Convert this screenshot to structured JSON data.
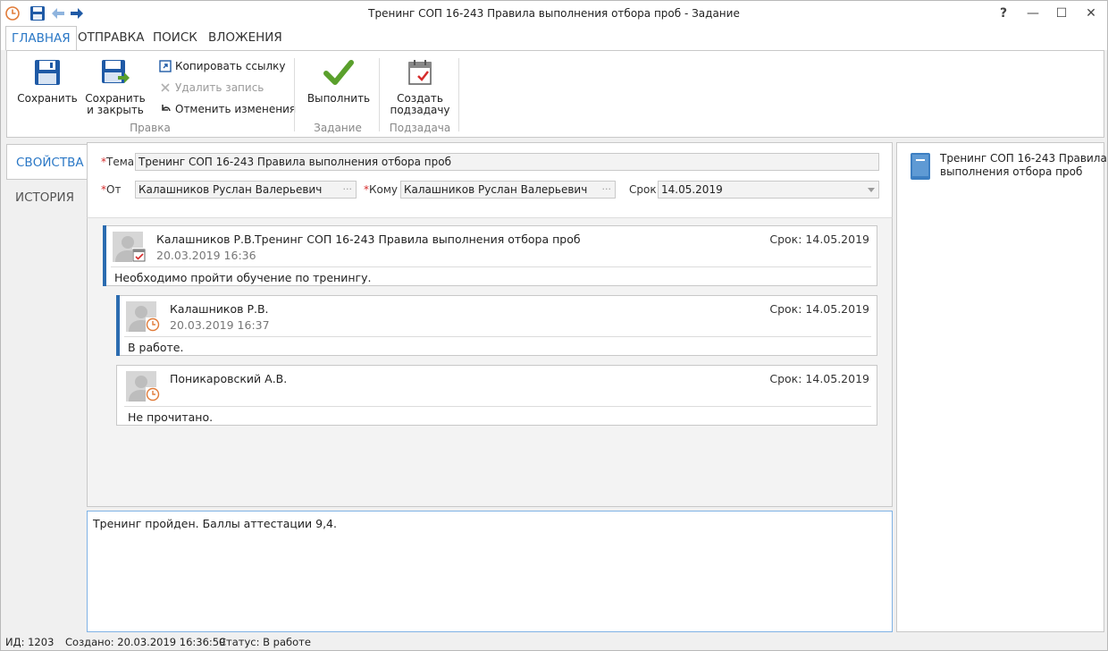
{
  "window": {
    "title": "Тренинг СОП 16-243 Правила выполнения отбора проб - Задание",
    "help_label": "?",
    "minimize_label": "—",
    "maximize_label": "☐",
    "close_label": "✕"
  },
  "tabs": [
    "ГЛАВНАЯ",
    "ОТПРАВКА",
    "ПОИСК",
    "ВЛОЖЕНИЯ"
  ],
  "ribbon": {
    "save": "Сохранить",
    "save_close_line1": "Сохранить",
    "save_close_line2": "и закрыть",
    "copy_link": "Копировать ссылку",
    "delete_record": "Удалить запись",
    "undo_changes": "Отменить изменения",
    "group_edit": "Правка",
    "complete": "Выполнить",
    "group_task": "Задание",
    "create_sub_line1": "Создать",
    "create_sub_line2": "подзадачу",
    "group_subtask": "Подзадача"
  },
  "side_tabs": [
    "СВОЙСТВА",
    "ИСТОРИЯ"
  ],
  "form": {
    "subject_label": "Тема",
    "subject_value": "Тренинг СОП 16-243 Правила выполнения отбора проб",
    "from_label": "От",
    "from_value": "Калашников Руслан Валерьевич",
    "to_label": "Кому",
    "to_value": "Калашников Руслан Валерьевич",
    "due_label": "Срок",
    "due_value": "14.05.2019",
    "required_mark": "*",
    "dots": "···"
  },
  "thread": [
    {
      "author": "Калашников Р.В.",
      "subject": "Тренинг СОП 16-243 Правила выполнения отбора проб",
      "date": "20.03.2019 16:36",
      "due": "Срок: 14.05.2019",
      "body": "Необходимо пройти обучение по тренингу.",
      "badge": "task-check-icon"
    },
    {
      "author": "Калашников Р.В.",
      "date": "20.03.2019 16:37",
      "due": "Срок: 14.05.2019",
      "body": "В работе.",
      "badge": "clock-icon"
    },
    {
      "author": "Поникаровский А.В.",
      "due": "Срок: 14.05.2019",
      "body": "Не прочитано.",
      "badge": "clock-icon"
    }
  ],
  "reply_text": "Тренинг пройден. Баллы аттестации 9,4.",
  "right_pane": {
    "doc_line1": "Тренинг СОП 16-243 Правила",
    "doc_line2": "выполнения отбора проб"
  },
  "status": {
    "id": "ИД: 1203",
    "created": "Создано: 20.03.2019 16:36:59",
    "state": "Статус: В работе"
  },
  "colors": {
    "accent": "#2b78c6",
    "check_green": "#5aa02c",
    "required_red": "#d52b2b",
    "clock_orange": "#e07b39"
  }
}
